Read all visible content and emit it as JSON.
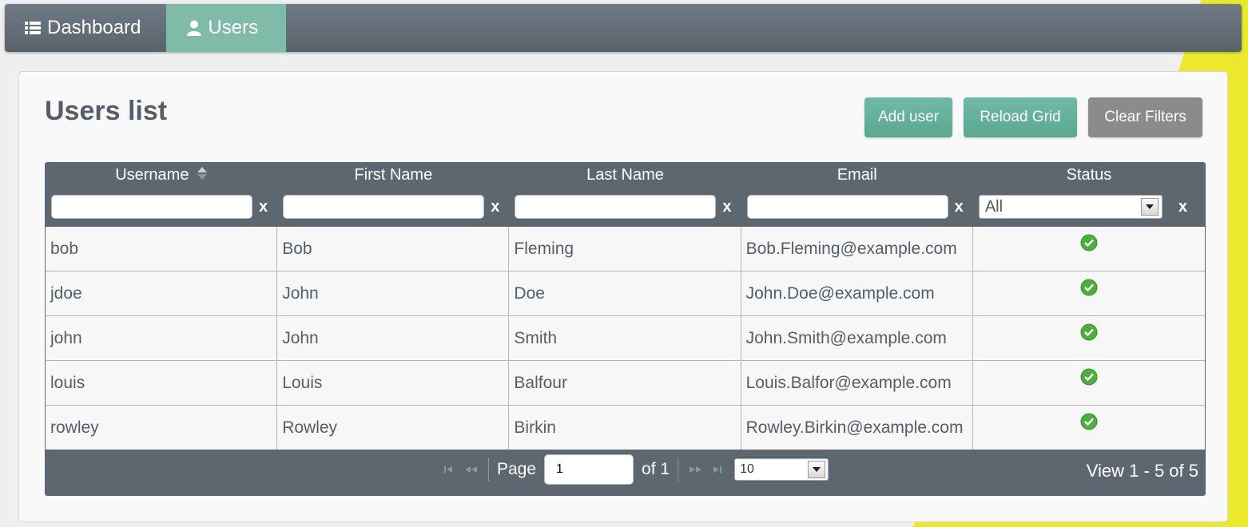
{
  "nav": {
    "items": [
      {
        "label": "Dashboard",
        "icon": "list-icon",
        "active": false
      },
      {
        "label": "Users",
        "icon": "user-icon",
        "active": true
      }
    ]
  },
  "page": {
    "title": "Users list"
  },
  "toolbar": {
    "add_label": "Add user",
    "reload_label": "Reload Grid",
    "clear_label": "Clear Filters"
  },
  "grid": {
    "columns": [
      "Username",
      "First Name",
      "Last Name",
      "Email",
      "Status"
    ],
    "sorted_column": "Username",
    "filters": {
      "username": "",
      "first_name": "",
      "last_name": "",
      "email": "",
      "status": "All",
      "clear_label": "x"
    },
    "rows": [
      {
        "username": "bob",
        "first_name": "Bob",
        "last_name": "Fleming",
        "email": "Bob.Fleming@example.com",
        "status": "check-circle-icon"
      },
      {
        "username": "jdoe",
        "first_name": "John",
        "last_name": "Doe",
        "email": "John.Doe@example.com",
        "status": "check-circle-icon"
      },
      {
        "username": "john",
        "first_name": "John",
        "last_name": "Smith",
        "email": "John.Smith@example.com",
        "status": "check-circle-icon"
      },
      {
        "username": "louis",
        "first_name": "Louis",
        "last_name": "Balfour",
        "email": "Louis.Balfor@example.com",
        "status": "check-circle-icon"
      },
      {
        "username": "rowley",
        "first_name": "Rowley",
        "last_name": "Birkin",
        "email": "Rowley.Birkin@example.com",
        "status": "check-circle-icon"
      }
    ]
  },
  "pager": {
    "page_label": "Page",
    "page_value": "1",
    "of_label": "of 1",
    "per_page": "10",
    "view_info": "View 1 - 5 of 5"
  },
  "colors": {
    "nav_bg": "#626c75",
    "nav_active": "#7fbba9",
    "accent_green": "#5fae98",
    "grid_header": "#5d6770",
    "status_ok": "#4cae3c",
    "background_accent": "#ece92b"
  }
}
